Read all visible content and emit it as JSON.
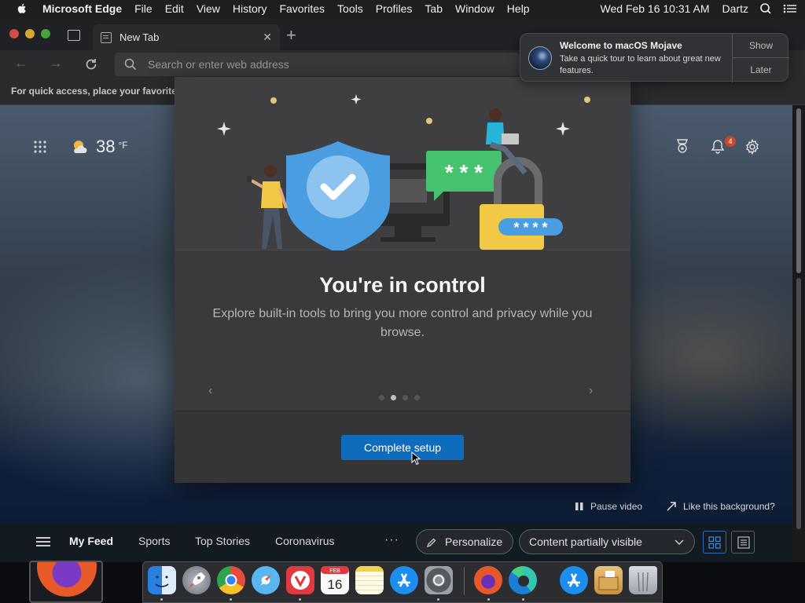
{
  "menubar": {
    "app_name": "Microsoft Edge",
    "items": [
      "File",
      "Edit",
      "View",
      "History",
      "Favorites",
      "Tools",
      "Profiles",
      "Tab",
      "Window",
      "Help"
    ],
    "datetime": "Wed Feb 16  10:31 AM",
    "user": "Dartz"
  },
  "browser": {
    "tab_title": "New Tab",
    "address_placeholder": "Search or enter web address",
    "favorites_bar_text": "For quick access, place your favorite"
  },
  "newtab": {
    "weather_temp": "38",
    "weather_unit": "°F",
    "notification_count": "4",
    "pause_video_label": "Pause video",
    "background_label": "Like this background?",
    "feed_nav": [
      "My Feed",
      "Sports",
      "Top Stories",
      "Coronavirus"
    ],
    "more_label": "···",
    "personalize_label": "Personalize",
    "content_visibility": "Content partially visible"
  },
  "setup_dialog": {
    "heading": "You're in control",
    "description": "Explore built-in tools to bring you more control and privacy while you browse.",
    "cta_label": "Complete setup",
    "total_slides": 4,
    "active_slide": 2,
    "chat_bubble_text": "* * *",
    "password_field_text": "* * * *"
  },
  "notification": {
    "title": "Welcome to macOS Mojave",
    "body": "Take a quick tour to learn about great new features.",
    "show_label": "Show",
    "later_label": "Later"
  },
  "dock": {
    "calendar_month": "FEB",
    "calendar_day": "16",
    "apps": [
      "finder-icon",
      "launchpad-icon",
      "chrome-icon",
      "safari-icon",
      "vivaldi-icon",
      "calendar-icon",
      "notes-icon",
      "app-store-icon",
      "system-preferences-icon",
      "firefox-icon",
      "edge-icon",
      "app-store-downloads-icon",
      "archive-utility-icon",
      "trash-icon"
    ]
  },
  "colors": {
    "accent": "#0f6cbd",
    "shield": "#4a9de0",
    "badge": "#c64a2a"
  }
}
